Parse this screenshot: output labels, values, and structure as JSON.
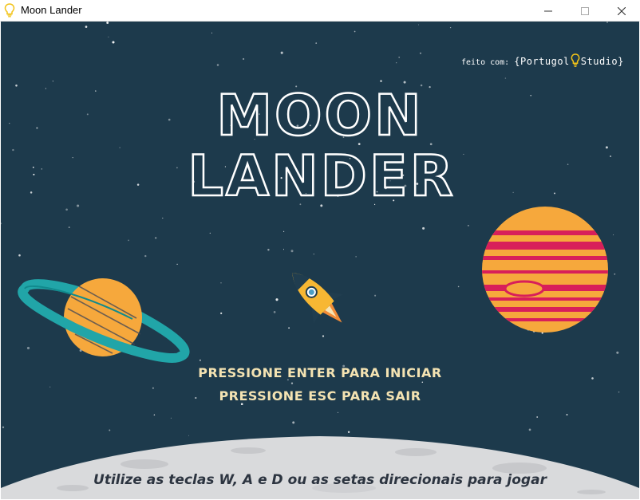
{
  "window": {
    "title": "Moon Lander",
    "minimize_symbol": "—",
    "maximize_symbol": "☐",
    "close_symbol": "✕"
  },
  "game": {
    "title_line1": "MOON",
    "title_line2": "LANDER",
    "credit_prefix": "feito com:",
    "credit_brand_left": "{Portugol",
    "credit_brand_right": "Studio}",
    "prompt_start": "Pressione Enter para iniciar",
    "prompt_exit": "Pressione Esc para sair",
    "controls_hint": "Utilize as teclas W, A e D  ou as setas direcionais para jogar"
  },
  "icons": {
    "app": "lightbulb-icon",
    "credit": "lightbulb-icon"
  },
  "colors": {
    "sky": "#1d3a4c",
    "title_stroke": "#ffffff",
    "prompt_text": "#f4e3b2",
    "moon_surface": "#d9dadc",
    "planet_orange": "#f6a83c",
    "planet_stripe": "#d81f5a",
    "ring_teal": "#21a5a8",
    "bulb_yellow": "#f2c318"
  }
}
